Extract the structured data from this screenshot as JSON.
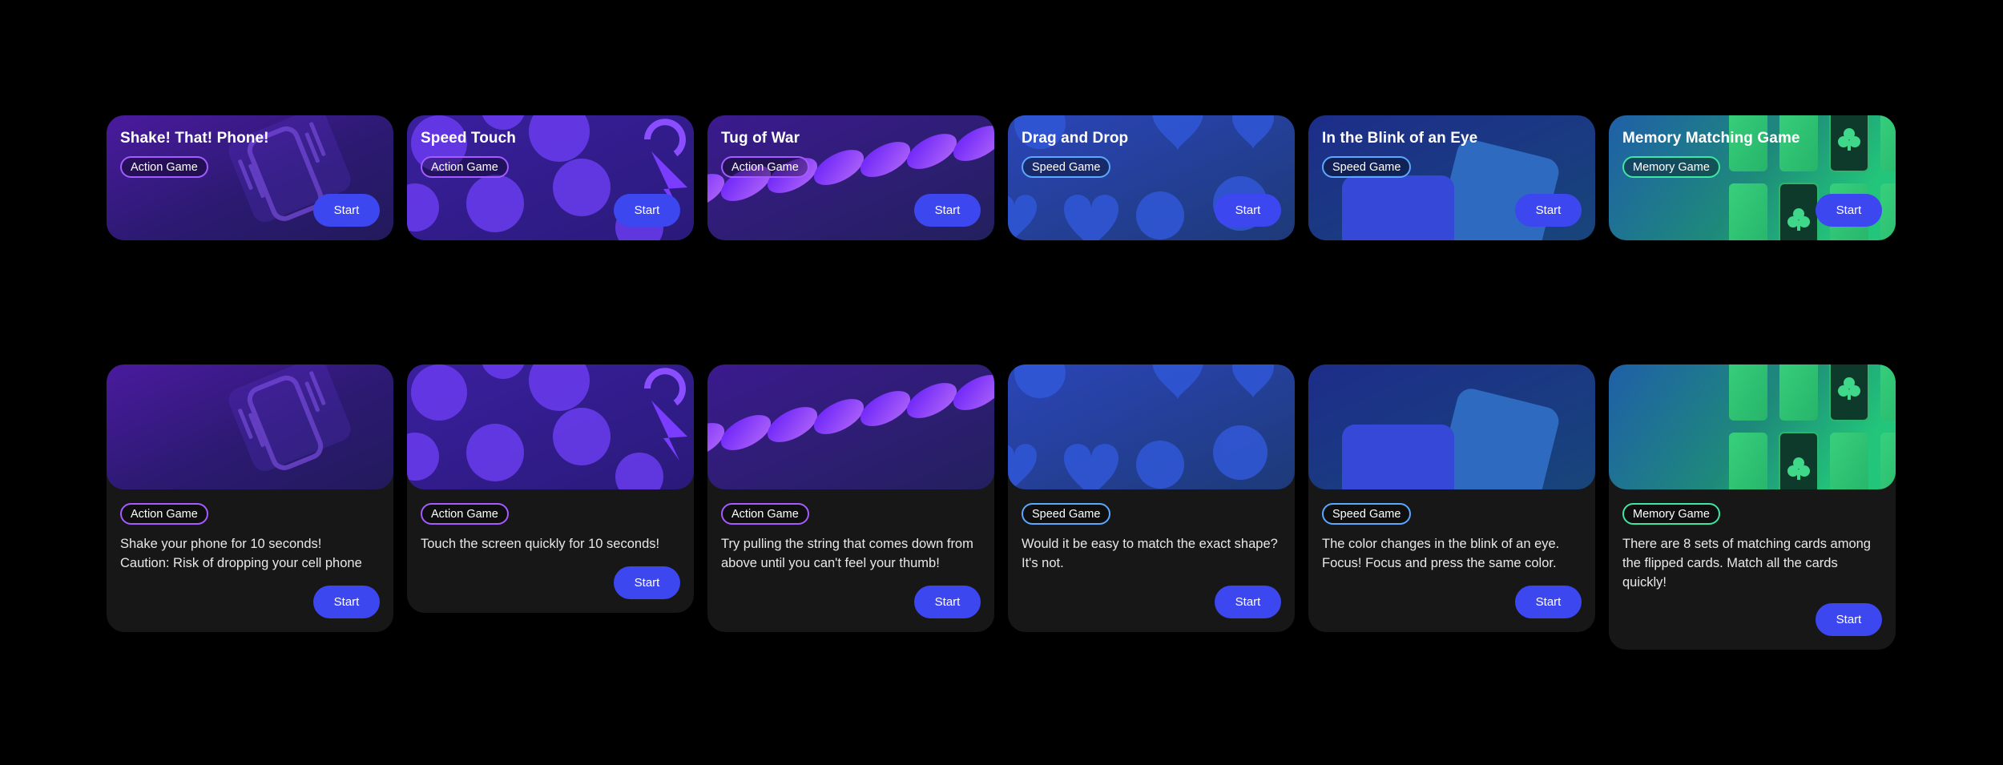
{
  "games": [
    {
      "id": "shake",
      "title": "Shake! That! Phone!",
      "tag": "Action Game",
      "tag_kind": "action",
      "desc": [
        "Shake your phone for 10 seconds!",
        "Caution: Risk of dropping your cell phone"
      ],
      "button": "Start",
      "icon": "phone-shake-icon"
    },
    {
      "id": "speed",
      "title": "Speed Touch",
      "tag": "Action Game",
      "tag_kind": "action",
      "desc": [
        "Touch the screen quickly for 10 seconds!"
      ],
      "button": "Start",
      "icon": "tap-circles-icon"
    },
    {
      "id": "tug",
      "title": "Tug of War",
      "tag": "Action Game",
      "tag_kind": "action",
      "desc": [
        "Try pulling the string that comes down from",
        "above until you can't feel your thumb!"
      ],
      "button": "Start",
      "icon": "rope-icon"
    },
    {
      "id": "drag",
      "title": "Drag and Drop",
      "tag": "Speed Game",
      "tag_kind": "speed",
      "desc": [
        "Would it be easy to match the exact shape?",
        "It's not."
      ],
      "button": "Start",
      "icon": "heart-shapes-icon"
    },
    {
      "id": "blink",
      "title": "In the Blink of an Eye",
      "tag": "Speed Game",
      "tag_kind": "speed",
      "desc": [
        "The color changes in the blink of an eye.",
        "Focus! Focus and press the same color."
      ],
      "button": "Start",
      "icon": "color-cards-icon"
    },
    {
      "id": "memory",
      "title": "Memory Matching Game",
      "tag": "Memory Game",
      "tag_kind": "memory",
      "desc": [
        "There are 8 sets of matching cards among",
        "the flipped cards. Match all the cards",
        "quickly!"
      ],
      "button": "Start",
      "icon": "club-cards-icon"
    }
  ]
}
